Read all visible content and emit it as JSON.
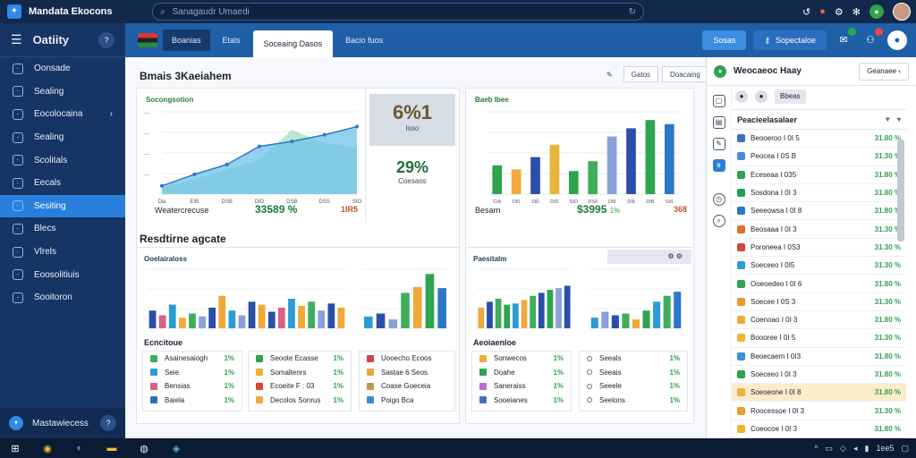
{
  "window": {
    "title": "Mandata Ekocons"
  },
  "search": {
    "placeholder": "Sanagaudr Umaedi"
  },
  "sidebar": {
    "header": "Oatiity",
    "header_badge": "?",
    "items": [
      {
        "label": "Oonsade",
        "icon": "home-icon"
      },
      {
        "label": "Sealing",
        "icon": "tag-icon"
      },
      {
        "label": "Eocolocaina",
        "icon": "folder-icon",
        "chevron": true
      },
      {
        "label": "Sealing",
        "icon": "settings-icon"
      },
      {
        "label": "Scolitals",
        "icon": "gear-icon"
      },
      {
        "label": "Eecals",
        "icon": "chart-icon"
      },
      {
        "label": "Sesiting",
        "icon": "check-icon",
        "active": true
      },
      {
        "label": "Blecs",
        "icon": "list-icon"
      },
      {
        "label": "Vlrels",
        "icon": "globe-icon"
      },
      {
        "label": "Eoosolitiuis",
        "icon": "link-icon"
      },
      {
        "label": "Sooitoron",
        "icon": "refresh-icon"
      }
    ],
    "footer": "Mastawiecess",
    "footer_badge": "?"
  },
  "topnav": {
    "tabs": [
      "Boanias",
      "Etals",
      "Soceaing Dasos",
      "Bacio fuos"
    ],
    "button": "Sosas",
    "button2": "Sopectaloe"
  },
  "main": {
    "title1": "Bmais 3Kaeiahem",
    "ctrl1": "Gatos",
    "ctrl2": "Doacaing",
    "title2": "Resdtirne agcate",
    "card1": {
      "label": "Socongsotion",
      "footer_left": "Weatercrecuse",
      "footer_value": "33589 %",
      "footer_right": "1IR5",
      "kpi_main": "6%1",
      "kpi_main_sub": "Isso",
      "kpi2": "29%",
      "kpi2_sub": "Coesaos"
    },
    "card2": {
      "label": "Baeb Ibee",
      "footer_left": "Besarn",
      "footer_value": "$3995",
      "footer_pct": "1%",
      "footer_right": "368"
    },
    "card3": {
      "label": "Ooelairaloss",
      "sub": "Ecncitoue",
      "legend1": [
        {
          "label": "Asainesaiogh",
          "pct": "1%"
        },
        {
          "label": "Seie",
          "pct": "1%"
        },
        {
          "label": "Bensias",
          "pct": "1%"
        },
        {
          "label": "Baiela",
          "pct": "1%"
        }
      ],
      "legend2": [
        {
          "label": "Seoote Ecasse",
          "pct": "1%"
        },
        {
          "label": "Somaltenrs",
          "pct": "1%"
        },
        {
          "label": "Ecoeite F : 03",
          "pct": "1%"
        },
        {
          "label": "Decolos Sonrus",
          "pct": "1%"
        }
      ],
      "legend3": [
        {
          "label": "Uooecho Ecoos"
        },
        {
          "label": "Sastae 6 Seos"
        },
        {
          "label": "Coase Goeceia"
        },
        {
          "label": "Poigo Bca"
        }
      ]
    },
    "card4": {
      "label": "Paesitalm",
      "sub": "Aeoiaenloe",
      "legend1": [
        {
          "label": "Sonwecos",
          "pct": "1%"
        },
        {
          "label": "Doahe",
          "pct": "1%"
        },
        {
          "label": "Saneraiss",
          "pct": "1%"
        },
        {
          "label": "Sooeianes",
          "pct": "1%"
        }
      ],
      "legend2": [
        {
          "label": "Seeals",
          "pct": "1%"
        },
        {
          "label": "Seeais",
          "pct": "1%"
        },
        {
          "label": "Seeele",
          "pct": "1%"
        },
        {
          "label": "Seelons",
          "pct": "1%"
        }
      ]
    }
  },
  "right_panel": {
    "title": "Weocaeoc Haay",
    "select": "Geanaee",
    "tool_button": "Bbeas",
    "list_header": "Peacieelasalaer",
    "rows": [
      {
        "label": "Beooeroo I 0I 5",
        "value": "31.80 %",
        "color": "#3a6fc4"
      },
      {
        "label": "Peocea I 0S B",
        "value": "31.30 %",
        "color": "#4a8ad8"
      },
      {
        "label": "Eceseaa I 035",
        "value": "31.80 %",
        "color": "#2da44e"
      },
      {
        "label": "Sosdona I 0I 3",
        "value": "31.80 %",
        "color": "#1f9e5a"
      },
      {
        "label": "Seeeowsa I 0I 8",
        "value": "31.80 %",
        "color": "#2a77c8"
      },
      {
        "label": "Beosaaa I 0I 3",
        "value": "31.30 %",
        "color": "#e0702a"
      },
      {
        "label": "Poroneea I 0S3",
        "value": "31.30 %",
        "color": "#d0483a"
      },
      {
        "label": "Soeceeo I 0I5",
        "value": "31.30 %",
        "color": "#2b9bd6"
      },
      {
        "label": "Ooeoedeo I 0I 6",
        "value": "31.80 %",
        "color": "#2da44e"
      },
      {
        "label": "Soecee I 0S 3",
        "value": "31.30 %",
        "color": "#e89a2a"
      },
      {
        "label": "Coenoao I 0I 3",
        "value": "31.80 %",
        "color": "#f0a93a"
      },
      {
        "label": "Boooree I 0I 5",
        "value": "31.30 %",
        "color": "#f2b531"
      },
      {
        "label": "Beoecaem I 0I3",
        "value": "31.80 %",
        "color": "#3c8fd8"
      },
      {
        "label": "Soeceeo I 0I 3",
        "value": "31.80 %",
        "color": "#2da44e"
      },
      {
        "label": "Soeoeone I 0I 8",
        "value": "31.80 %",
        "color": "#e8b33a",
        "hl": true
      },
      {
        "label": "Roocessoe I 0I 3",
        "value": "31.30 %",
        "color": "#f09a2a"
      },
      {
        "label": "Coeocoe I 0I 3",
        "value": "31.80 %",
        "color": "#f2b531"
      }
    ]
  },
  "taskbar": {
    "tray": "1ee5"
  },
  "chart_data": [
    {
      "type": "area",
      "x": [
        "Dia",
        "EIB",
        "DSB",
        "DID",
        "DSB",
        "DSS",
        "SIO"
      ],
      "series": [
        {
          "values": [
            10,
            24,
            36,
            58,
            64,
            72,
            82
          ]
        },
        {
          "values": [
            8,
            18,
            30,
            42,
            78,
            62,
            56
          ]
        }
      ]
    },
    {
      "type": "bar",
      "categories": [
        "CiA",
        "DI0",
        "SiD",
        "DID",
        "SIO",
        "DS0",
        "DI8",
        "DI8",
        "DIB",
        "SiS"
      ],
      "series": [
        {
          "values": [
            35,
            30,
            45,
            60,
            28,
            40,
            70,
            80,
            90,
            85
          ]
        }
      ]
    }
  ]
}
